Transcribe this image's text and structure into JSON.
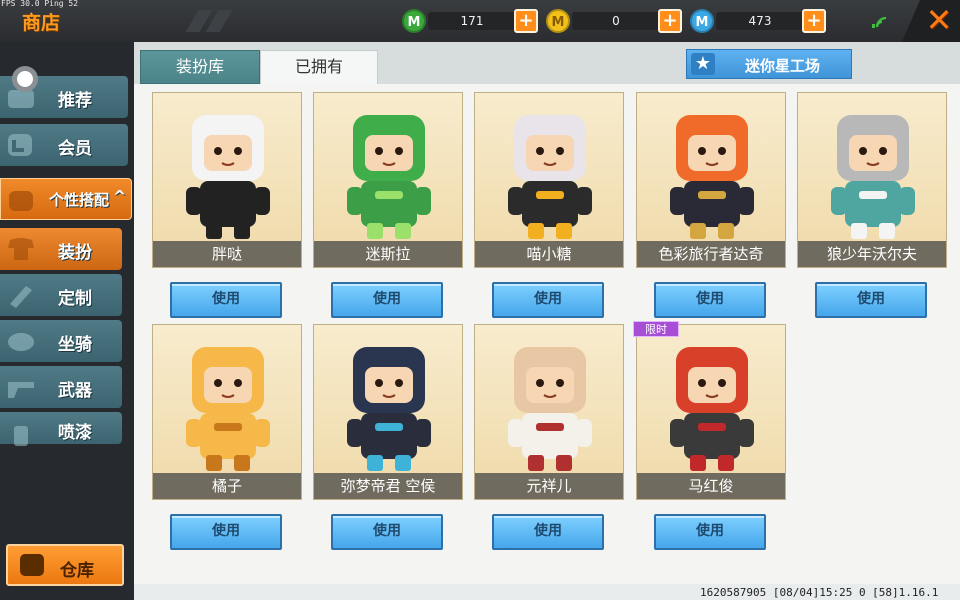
{
  "debug": {
    "fps_text": "FPS 30.0  Ping 52"
  },
  "header": {
    "title": "商店"
  },
  "currencies": [
    {
      "icon": "mini-bean-icon",
      "value": "171",
      "color": "#3aa83a"
    },
    {
      "icon": "mini-coin-icon",
      "value": "0",
      "color": "#f2c21a"
    },
    {
      "icon": "mini-point-icon",
      "value": "473",
      "color": "#3ba8e6"
    }
  ],
  "sidebar": {
    "items": [
      {
        "label": "推荐",
        "icon": "thumb-icon"
      },
      {
        "label": "会员",
        "icon": "vip-icon"
      },
      {
        "label": "个性搭配",
        "icon": "puzzle-icon"
      },
      {
        "label": "装扮",
        "icon": "shirt-icon"
      },
      {
        "label": "定制",
        "icon": "brush-icon"
      },
      {
        "label": "坐骑",
        "icon": "mount-icon"
      },
      {
        "label": "武器",
        "icon": "gun-icon"
      },
      {
        "label": "喷漆",
        "icon": "spray-icon"
      }
    ],
    "warehouse_label": "仓库"
  },
  "tabs": [
    {
      "label": "装扮库",
      "active": true
    },
    {
      "label": "已拥有",
      "active": false
    }
  ],
  "workshop_label": "迷你星工场",
  "limited_badge": "限时",
  "use_label": "使用",
  "skins": [
    {
      "name": "胖哒",
      "limited": false,
      "head": "#f4f4f4",
      "body": "#222222",
      "accent": "#222222"
    },
    {
      "name": "迷斯拉",
      "limited": false,
      "head": "#3fae4a",
      "body": "#3c9e46",
      "accent": "#9be06a"
    },
    {
      "name": "喵小糖",
      "limited": false,
      "head": "#e8e4ea",
      "body": "#2b2b2b",
      "accent": "#f2b020"
    },
    {
      "name": "色彩旅行者达奇",
      "limited": false,
      "head": "#f06a2a",
      "body": "#2a2a36",
      "accent": "#d4a640"
    },
    {
      "name": "狼少年沃尔夫",
      "limited": false,
      "head": "#b8b8b8",
      "body": "#4fa6a0",
      "accent": "#f4f4f4"
    },
    {
      "name": "橘子",
      "limited": false,
      "head": "#f6b848",
      "body": "#f6b848",
      "accent": "#c8781a"
    },
    {
      "name": "弥梦帝君 空侯",
      "limited": false,
      "head": "#2a3650",
      "body": "#2a2e3c",
      "accent": "#3fb2d8"
    },
    {
      "name": "元祥儿",
      "limited": false,
      "head": "#e8c8a4",
      "body": "#f4f0ea",
      "accent": "#b03030"
    },
    {
      "name": "马红俊",
      "limited": true,
      "head": "#d8402a",
      "body": "#3a3a3a",
      "accent": "#c0282a"
    }
  ],
  "footer": {
    "version_text": "1620587905  [08/04]15:25 0  [58]1.16.1"
  }
}
